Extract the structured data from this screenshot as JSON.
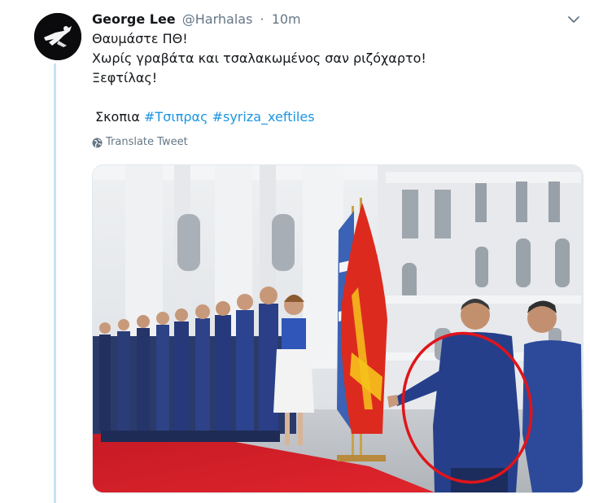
{
  "tweet": {
    "author_name": "George Lee",
    "author_handle": "@Harhalas",
    "separator": "·",
    "time": "10m",
    "lines": [
      "Θαυμάστε ΠΘ!",
      "Χωρίς γραβάτα και τσαλακωμένος σαν ριζόχαρτο!",
      "Ξεφτίλας!"
    ],
    "location_word": "Σκοπια",
    "hashtags": [
      "#Τσιπρας",
      "#syriza_xeftiles"
    ],
    "translate_label": "Translate Tweet"
  },
  "icons": {
    "caret": "chevron-down-icon",
    "translate": "globe-icon"
  },
  "colors": {
    "link": "#1b95e0",
    "secondary": "#657786",
    "thread_line": "#c4e3f7",
    "annotation_circle": "#e0141b"
  }
}
